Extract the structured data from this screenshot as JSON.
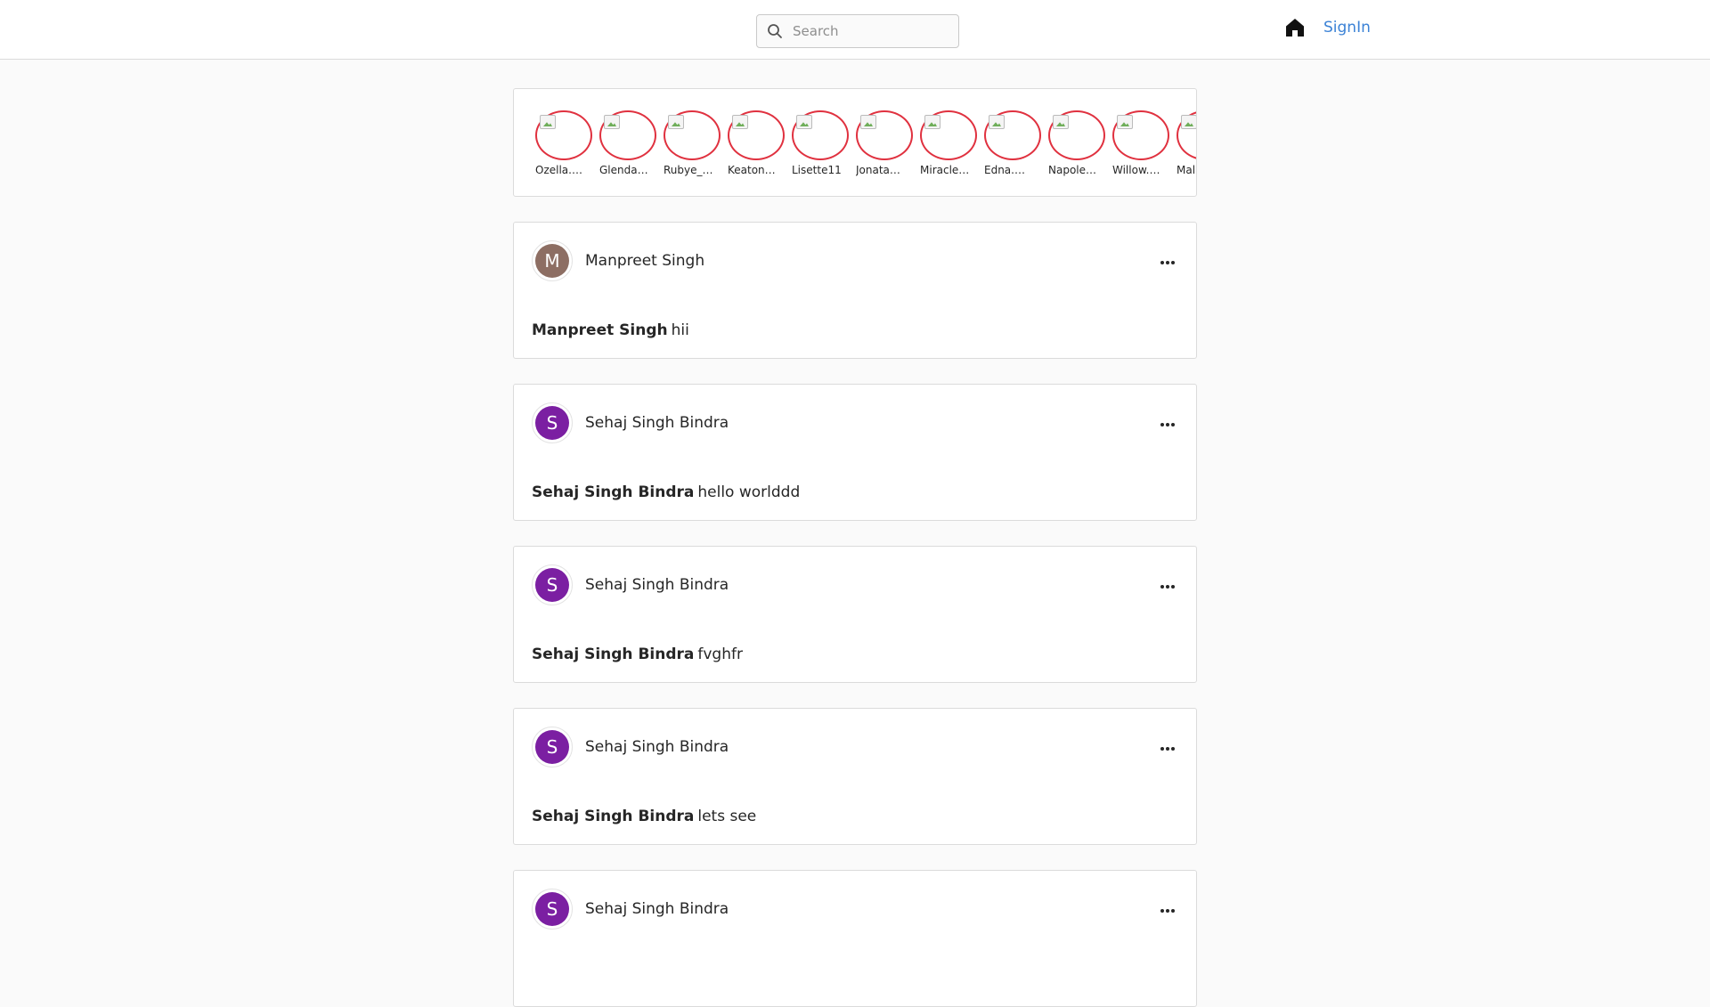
{
  "header": {
    "search_placeholder": "Search",
    "signin_label": "SignIn"
  },
  "stories": [
    {
      "name": "Ozella.…"
    },
    {
      "name": "Glenda…"
    },
    {
      "name": "Rubye_…"
    },
    {
      "name": "Keaton…"
    },
    {
      "name": "Lisette11"
    },
    {
      "name": "Jonata…"
    },
    {
      "name": "Miracle…"
    },
    {
      "name": "Edna.…"
    },
    {
      "name": "Napole…"
    },
    {
      "name": "Willow.…"
    },
    {
      "name": "Mal…"
    }
  ],
  "posts": [
    {
      "initial": "M",
      "avatar_color": "#8d6e63",
      "user": "Manpreet Singh",
      "caption_user": "Manpreet Singh",
      "caption_text": "hii"
    },
    {
      "initial": "S",
      "avatar_color": "#7b1fa2",
      "user": "Sehaj Singh Bindra",
      "caption_user": "Sehaj Singh Bindra",
      "caption_text": "hello worlddd"
    },
    {
      "initial": "S",
      "avatar_color": "#7b1fa2",
      "user": "Sehaj Singh Bindra",
      "caption_user": "Sehaj Singh Bindra",
      "caption_text": "fvghfr"
    },
    {
      "initial": "S",
      "avatar_color": "#7b1fa2",
      "user": "Sehaj Singh Bindra",
      "caption_user": "Sehaj Singh Bindra",
      "caption_text": "lets see"
    },
    {
      "initial": "S",
      "avatar_color": "#7b1fa2",
      "user": "Sehaj Singh Bindra",
      "caption_user": "",
      "caption_text": ""
    }
  ],
  "colors": {
    "story_ring": "#e0313f",
    "link": "#3b82d6"
  },
  "icons": {
    "search": "search-icon",
    "home": "home-icon",
    "more": "more-horizontal-icon"
  }
}
